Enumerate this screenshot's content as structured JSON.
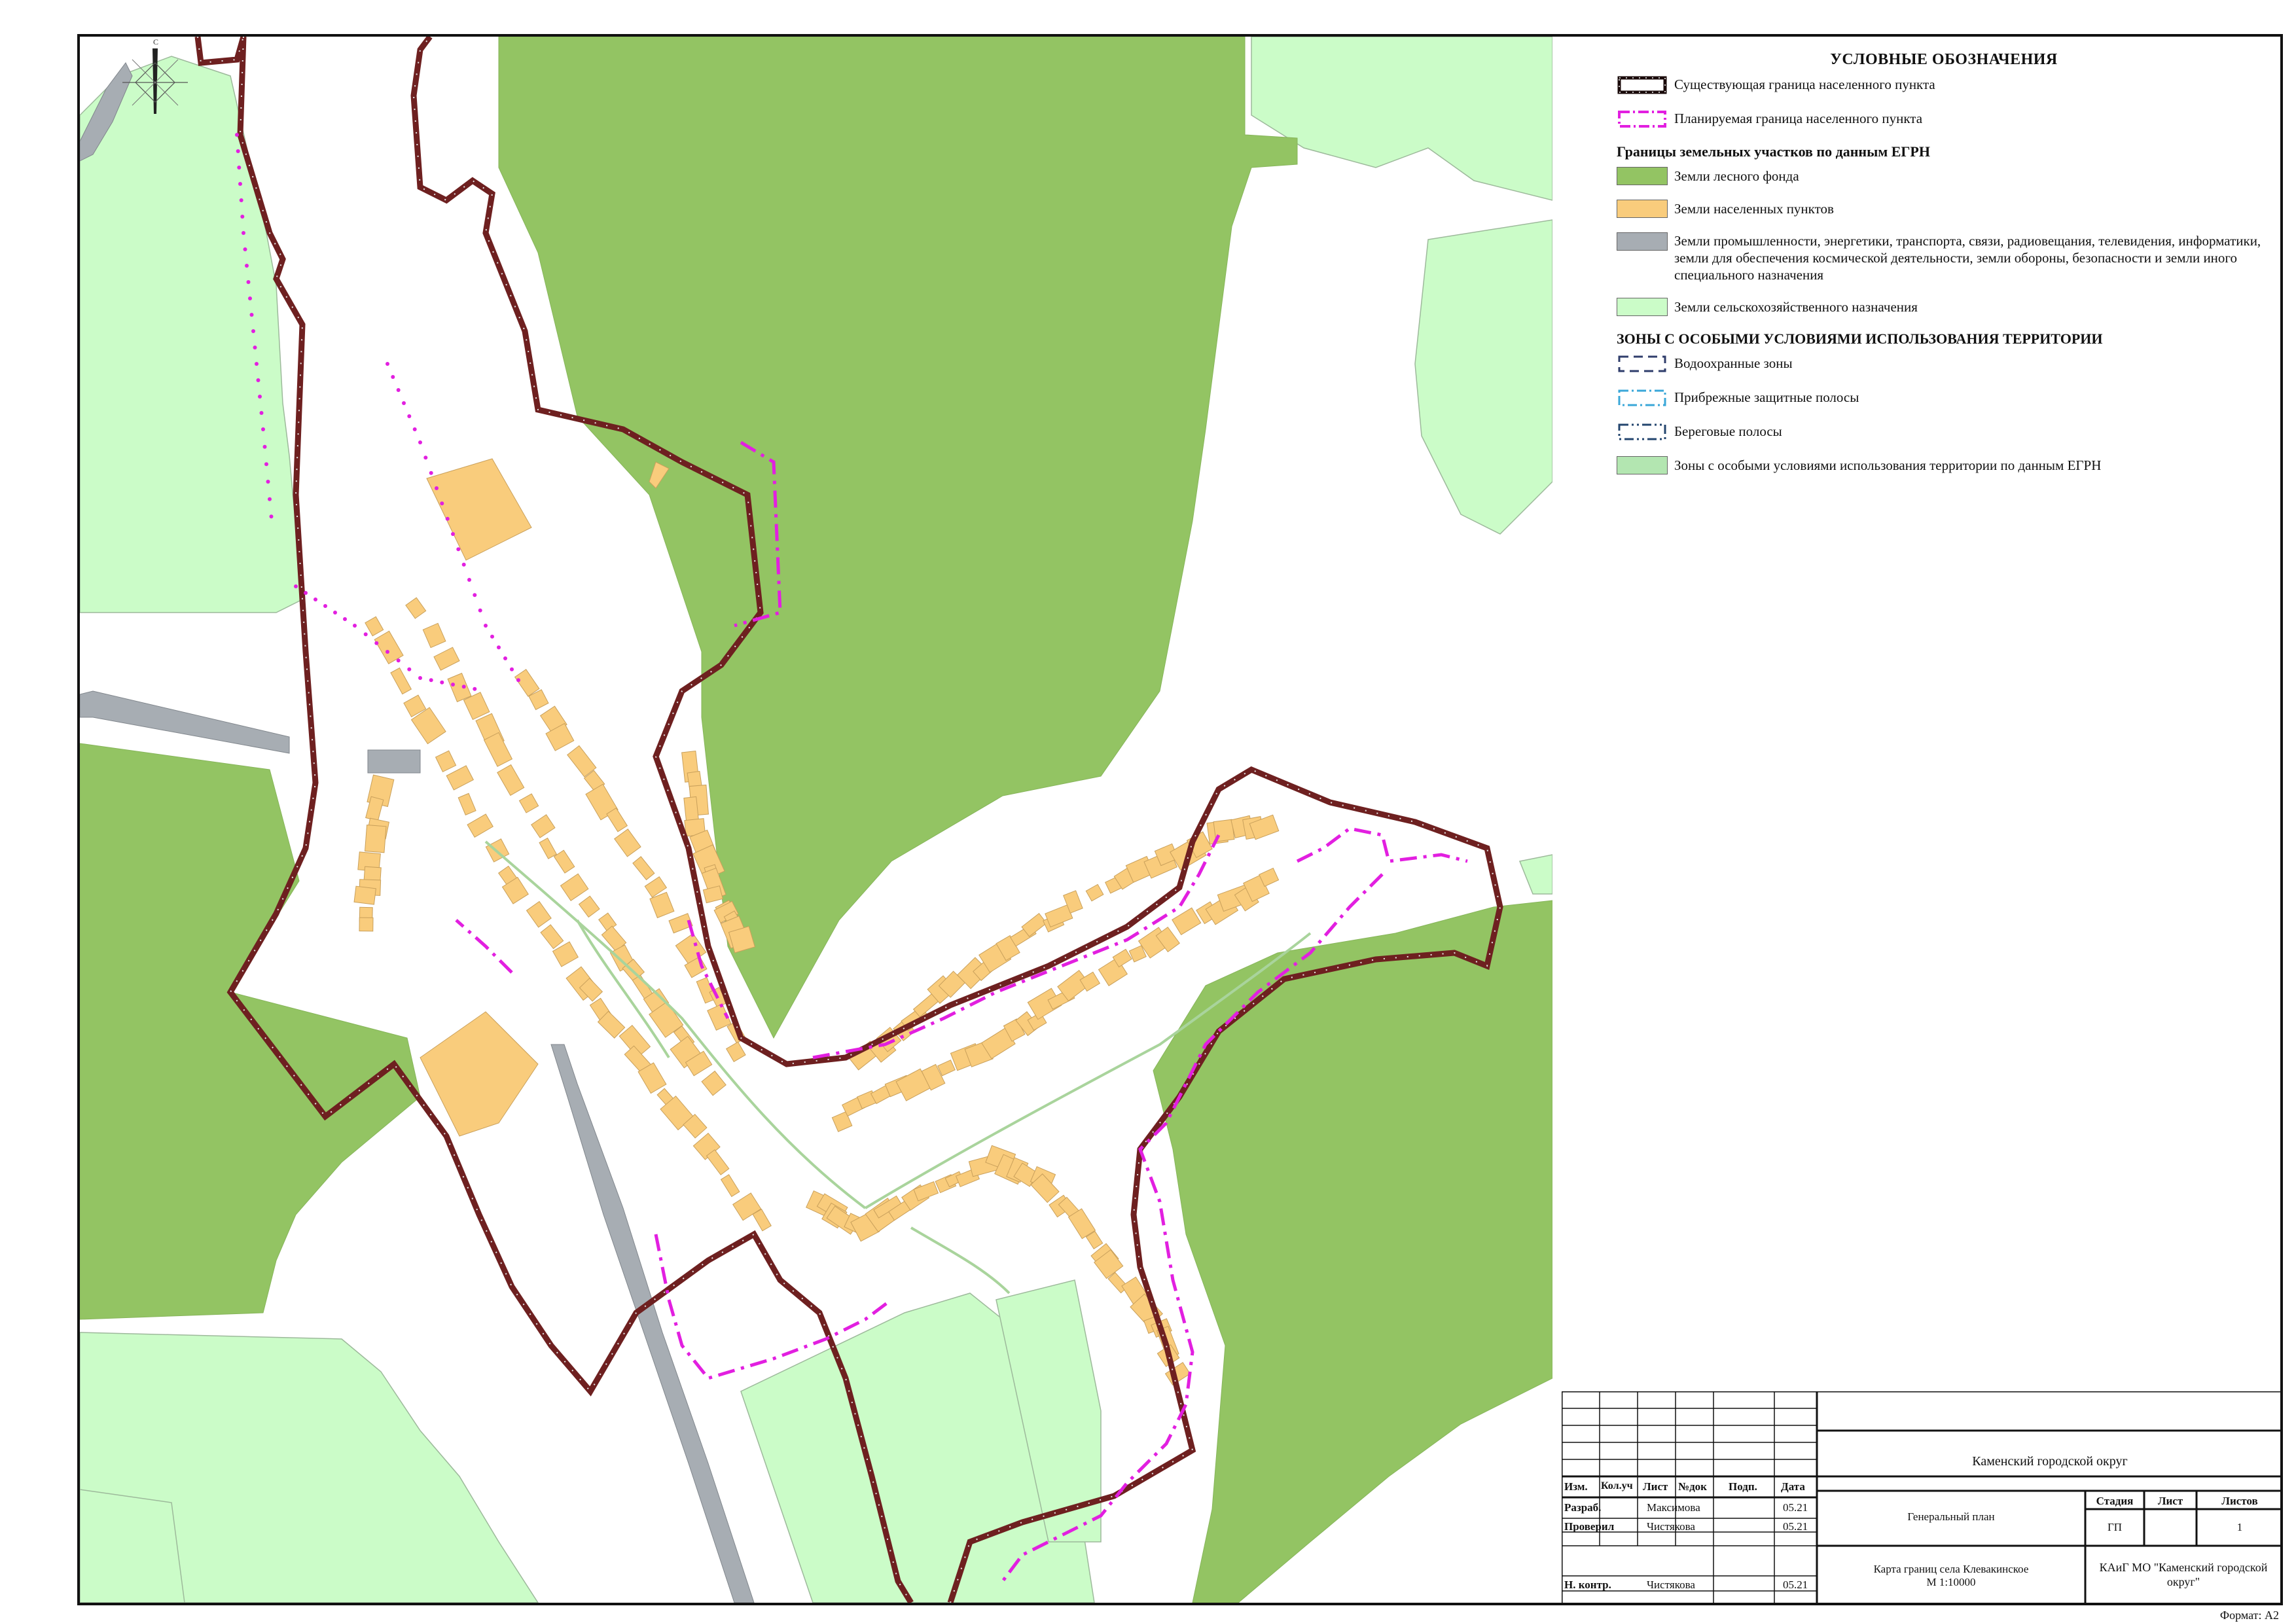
{
  "legend": {
    "title": "УСЛОВНЫЕ ОБОЗНАЧЕНИЯ",
    "boundaries": [
      {
        "label": "Существующая граница населенного пункта",
        "symbol": "existing-boundary"
      },
      {
        "label": "Планируемая граница населенного пункта",
        "symbol": "planned-boundary"
      }
    ],
    "egrn_heading": "Границы земельных участков по данным ЕГРН",
    "land_categories": [
      {
        "label": "Земли лесного фонда",
        "color": "#93c463"
      },
      {
        "label": "Земли населенных пунктов",
        "color": "#f9cc7c"
      },
      {
        "label": "Земли промышленности, энергетики, транспорта, связи, радиовещания, телевидения, информатики, земли для обеспечения космической деятельности, земли обороны, безопасности и земли иного специального назначения",
        "color": "#a7adb3"
      },
      {
        "label": "Земли сельскохозяйственного назначения",
        "color": "#cbfcc8"
      }
    ],
    "zones_heading": "ЗОНЫ С ОСОБЫМИ УСЛОВИЯМИ ИСПОЛЬЗОВАНИЯ ТЕРРИТОРИИ",
    "zones": [
      {
        "label": "Водоохранные зоны",
        "symbol": "water-protection"
      },
      {
        "label": "Прибрежные защитные полосы",
        "symbol": "coastal-strip"
      },
      {
        "label": "Береговые полосы",
        "symbol": "shore-strip"
      },
      {
        "label": "Зоны с особыми условиями использования территории по данным ЕГРН",
        "symbol": "egrn-zone",
        "color": "#b3e6b1"
      }
    ]
  },
  "north_arrow_label": "С",
  "title_block": {
    "columns": [
      "Изм.",
      "Кол.уч",
      "Лист",
      "№док",
      "Подп.",
      "Дата"
    ],
    "rows": [
      {
        "role": "Разраб.",
        "name": "Максимова",
        "date": "05.21"
      },
      {
        "role": "Проверил",
        "name": "Чистякова",
        "date": "05.21"
      },
      {
        "role": "Н. контр.",
        "name": "Чистякова",
        "date": "05.21"
      }
    ],
    "project": "Каменский городской округ",
    "document": "Генеральный план",
    "sheet_title": "Карта границ села Клевакинское",
    "scale": "М 1:10000",
    "stage_label": "Стадия",
    "sheet_label": "Лист",
    "sheets_label": "Листов",
    "stage": "ГП",
    "sheet": "",
    "sheets": "1",
    "organization": "КАиГ МО \"Каменский городской округ\""
  },
  "format_label": "Формат: А2"
}
